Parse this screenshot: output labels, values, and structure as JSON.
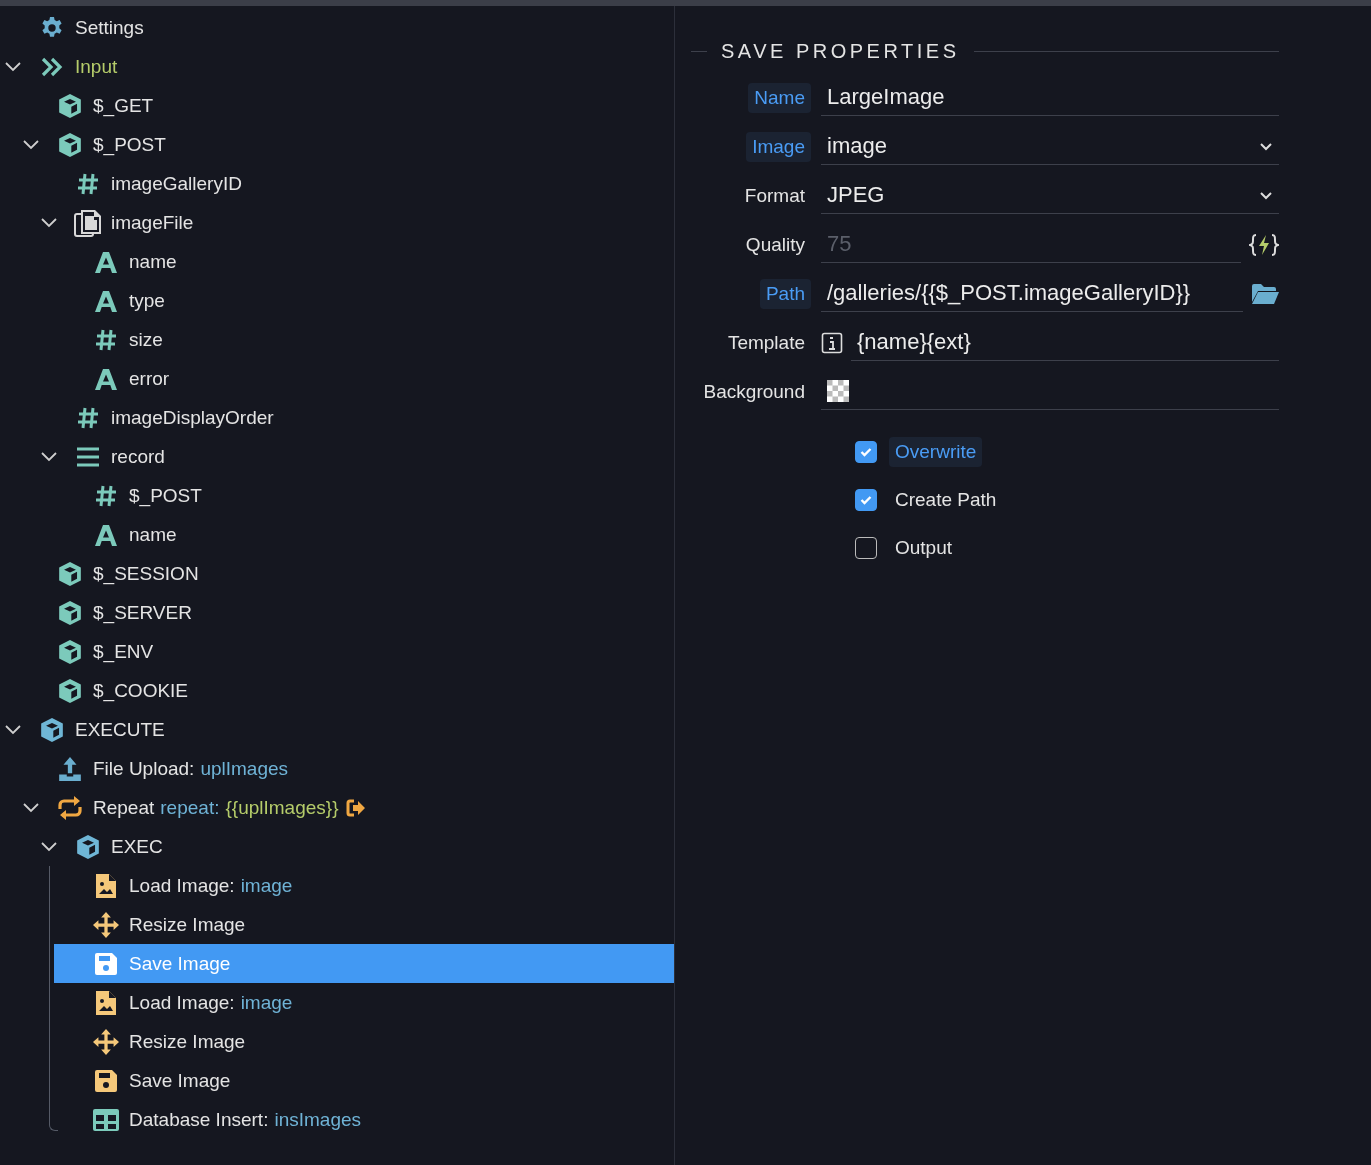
{
  "tree": [
    {
      "kind": "settings",
      "label": "Settings",
      "selected": false
    },
    {
      "kind": "input",
      "label": "Input",
      "selected": false,
      "expanded": true,
      "children": [
        {
          "kind": "object",
          "label": "$_GET",
          "selected": false
        },
        {
          "kind": "object",
          "label": "$_POST",
          "selected": false,
          "expanded": true,
          "children": [
            {
              "kind": "number",
              "label": "imageGalleryID",
              "selected": false
            },
            {
              "kind": "file",
              "label": "imageFile",
              "selected": false,
              "expanded": true,
              "children": [
                {
                  "kind": "text",
                  "label": "name",
                  "selected": false
                },
                {
                  "kind": "text",
                  "label": "type",
                  "selected": false
                },
                {
                  "kind": "number",
                  "label": "size",
                  "selected": false
                },
                {
                  "kind": "text",
                  "label": "error",
                  "selected": false
                }
              ]
            },
            {
              "kind": "number",
              "label": "imageDisplayOrder",
              "selected": false
            },
            {
              "kind": "array",
              "label": "record",
              "selected": false,
              "expanded": true,
              "children": [
                {
                  "kind": "number",
                  "label": "$_POST",
                  "selected": false
                },
                {
                  "kind": "text",
                  "label": "name",
                  "selected": false
                }
              ]
            }
          ]
        },
        {
          "kind": "object",
          "label": "$_SESSION",
          "selected": false
        },
        {
          "kind": "object",
          "label": "$_SERVER",
          "selected": false
        },
        {
          "kind": "object",
          "label": "$_ENV",
          "selected": false
        },
        {
          "kind": "object",
          "label": "$_COOKIE",
          "selected": false
        }
      ]
    },
    {
      "kind": "steps",
      "label": "EXECUTE",
      "selected": false,
      "expanded": true,
      "children": [
        {
          "kind": "upload",
          "label": "File Upload:",
          "detail": "uplImages",
          "selected": false
        },
        {
          "kind": "repeat",
          "label": "Repeat",
          "detail": "repeat:",
          "expr": "{{uplImages}}",
          "has_output": true,
          "selected": false,
          "expanded": true,
          "children": [
            {
              "kind": "steps",
              "label": "EXEC",
              "selected": false,
              "expanded": true,
              "guide_line": true,
              "children": [
                {
                  "kind": "load",
                  "label": "Load Image:",
                  "detail": "image",
                  "selected": false
                },
                {
                  "kind": "resize",
                  "label": "Resize Image",
                  "selected": false
                },
                {
                  "kind": "save",
                  "label": "Save Image",
                  "selected": true
                },
                {
                  "kind": "load",
                  "label": "Load Image:",
                  "detail": "image",
                  "selected": false
                },
                {
                  "kind": "resize",
                  "label": "Resize Image",
                  "selected": false
                },
                {
                  "kind": "save",
                  "label": "Save Image",
                  "selected": false
                },
                {
                  "kind": "table",
                  "label": "Database Insert:",
                  "detail": "insImages",
                  "selected": false
                }
              ]
            }
          ]
        }
      ]
    }
  ],
  "properties": {
    "title": "SAVE PROPERTIES",
    "fields": [
      {
        "label": "Name",
        "bound": true,
        "kind": "text",
        "value": "LargeImage"
      },
      {
        "label": "Image",
        "bound": true,
        "kind": "select",
        "value": "image"
      },
      {
        "label": "Format",
        "bound": false,
        "kind": "select",
        "value": "JPEG"
      },
      {
        "label": "Quality",
        "bound": false,
        "kind": "text",
        "placeholder": "75",
        "expression_button": true
      },
      {
        "label": "Path",
        "bound": true,
        "kind": "text",
        "value": "/galleries/{{$_POST.imageGalleryID}}",
        "browse_button": true
      },
      {
        "label": "Template",
        "bound": false,
        "kind": "text",
        "value": "{name}{ext}",
        "info": true
      },
      {
        "label": "Background",
        "bound": false,
        "kind": "color"
      }
    ],
    "options": [
      {
        "label": "Overwrite",
        "bound": true,
        "checked": true
      },
      {
        "label": "Create Path",
        "bound": false,
        "checked": true
      },
      {
        "label": "Output",
        "bound": false,
        "checked": false
      }
    ]
  }
}
